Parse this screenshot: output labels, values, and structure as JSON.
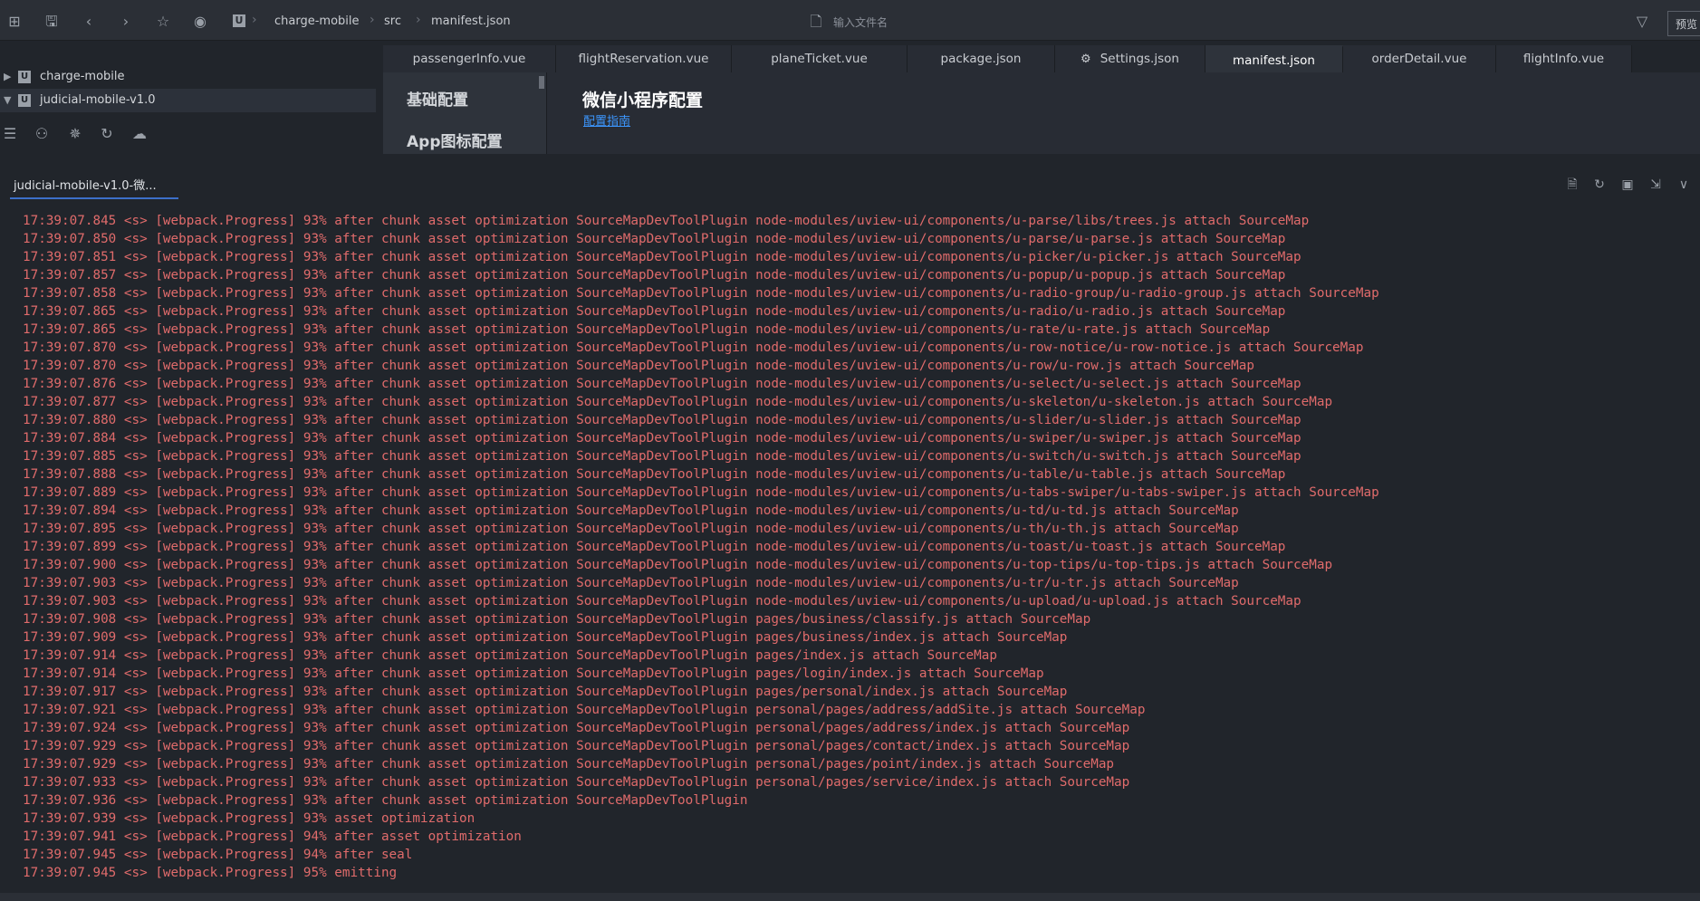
{
  "toolbar": {
    "breadcrumb": [
      "charge-mobile",
      "src",
      "manifest.json"
    ],
    "search_placeholder": "输入文件名",
    "preview_label": "预览"
  },
  "sidebar": {
    "projects": [
      {
        "label": "charge-mobile",
        "expanded": false
      },
      {
        "label": "judicial-mobile-v1.0",
        "expanded": true
      }
    ]
  },
  "tabs": [
    {
      "label": "passengerInfo.vue"
    },
    {
      "label": "flightReservation.vue"
    },
    {
      "label": "planeTicket.vue"
    },
    {
      "label": "package.json"
    },
    {
      "label": "Settings.json"
    },
    {
      "label": "manifest.json",
      "active": true
    },
    {
      "label": "orderDetail.vue"
    },
    {
      "label": "flightInfo.vue"
    }
  ],
  "manifest": {
    "nav_items": [
      "基础配置",
      "App图标配置"
    ],
    "title": "微信小程序配置",
    "guide_link": "配置指南"
  },
  "console": {
    "tab_label": "judicial-mobile-v1.0-微...",
    "lines": [
      "17:39:07.845 <s> [webpack.Progress] 93% after chunk asset optimization SourceMapDevToolPlugin node-modules/uview-ui/components/u-parse/libs/trees.js attach SourceMap",
      "17:39:07.850 <s> [webpack.Progress] 93% after chunk asset optimization SourceMapDevToolPlugin node-modules/uview-ui/components/u-parse/u-parse.js attach SourceMap",
      "17:39:07.851 <s> [webpack.Progress] 93% after chunk asset optimization SourceMapDevToolPlugin node-modules/uview-ui/components/u-picker/u-picker.js attach SourceMap",
      "17:39:07.857 <s> [webpack.Progress] 93% after chunk asset optimization SourceMapDevToolPlugin node-modules/uview-ui/components/u-popup/u-popup.js attach SourceMap",
      "17:39:07.858 <s> [webpack.Progress] 93% after chunk asset optimization SourceMapDevToolPlugin node-modules/uview-ui/components/u-radio-group/u-radio-group.js attach SourceMap",
      "17:39:07.865 <s> [webpack.Progress] 93% after chunk asset optimization SourceMapDevToolPlugin node-modules/uview-ui/components/u-radio/u-radio.js attach SourceMap",
      "17:39:07.865 <s> [webpack.Progress] 93% after chunk asset optimization SourceMapDevToolPlugin node-modules/uview-ui/components/u-rate/u-rate.js attach SourceMap",
      "17:39:07.870 <s> [webpack.Progress] 93% after chunk asset optimization SourceMapDevToolPlugin node-modules/uview-ui/components/u-row-notice/u-row-notice.js attach SourceMap",
      "17:39:07.870 <s> [webpack.Progress] 93% after chunk asset optimization SourceMapDevToolPlugin node-modules/uview-ui/components/u-row/u-row.js attach SourceMap",
      "17:39:07.876 <s> [webpack.Progress] 93% after chunk asset optimization SourceMapDevToolPlugin node-modules/uview-ui/components/u-select/u-select.js attach SourceMap",
      "17:39:07.877 <s> [webpack.Progress] 93% after chunk asset optimization SourceMapDevToolPlugin node-modules/uview-ui/components/u-skeleton/u-skeleton.js attach SourceMap",
      "17:39:07.880 <s> [webpack.Progress] 93% after chunk asset optimization SourceMapDevToolPlugin node-modules/uview-ui/components/u-slider/u-slider.js attach SourceMap",
      "17:39:07.884 <s> [webpack.Progress] 93% after chunk asset optimization SourceMapDevToolPlugin node-modules/uview-ui/components/u-swiper/u-swiper.js attach SourceMap",
      "17:39:07.885 <s> [webpack.Progress] 93% after chunk asset optimization SourceMapDevToolPlugin node-modules/uview-ui/components/u-switch/u-switch.js attach SourceMap",
      "17:39:07.888 <s> [webpack.Progress] 93% after chunk asset optimization SourceMapDevToolPlugin node-modules/uview-ui/components/u-table/u-table.js attach SourceMap",
      "17:39:07.889 <s> [webpack.Progress] 93% after chunk asset optimization SourceMapDevToolPlugin node-modules/uview-ui/components/u-tabs-swiper/u-tabs-swiper.js attach SourceMap",
      "17:39:07.894 <s> [webpack.Progress] 93% after chunk asset optimization SourceMapDevToolPlugin node-modules/uview-ui/components/u-td/u-td.js attach SourceMap",
      "17:39:07.895 <s> [webpack.Progress] 93% after chunk asset optimization SourceMapDevToolPlugin node-modules/uview-ui/components/u-th/u-th.js attach SourceMap",
      "17:39:07.899 <s> [webpack.Progress] 93% after chunk asset optimization SourceMapDevToolPlugin node-modules/uview-ui/components/u-toast/u-toast.js attach SourceMap",
      "17:39:07.900 <s> [webpack.Progress] 93% after chunk asset optimization SourceMapDevToolPlugin node-modules/uview-ui/components/u-top-tips/u-top-tips.js attach SourceMap",
      "17:39:07.903 <s> [webpack.Progress] 93% after chunk asset optimization SourceMapDevToolPlugin node-modules/uview-ui/components/u-tr/u-tr.js attach SourceMap",
      "17:39:07.903 <s> [webpack.Progress] 93% after chunk asset optimization SourceMapDevToolPlugin node-modules/uview-ui/components/u-upload/u-upload.js attach SourceMap",
      "17:39:07.908 <s> [webpack.Progress] 93% after chunk asset optimization SourceMapDevToolPlugin pages/business/classify.js attach SourceMap",
      "17:39:07.909 <s> [webpack.Progress] 93% after chunk asset optimization SourceMapDevToolPlugin pages/business/index.js attach SourceMap",
      "17:39:07.914 <s> [webpack.Progress] 93% after chunk asset optimization SourceMapDevToolPlugin pages/index.js attach SourceMap",
      "17:39:07.914 <s> [webpack.Progress] 93% after chunk asset optimization SourceMapDevToolPlugin pages/login/index.js attach SourceMap",
      "17:39:07.917 <s> [webpack.Progress] 93% after chunk asset optimization SourceMapDevToolPlugin pages/personal/index.js attach SourceMap",
      "17:39:07.921 <s> [webpack.Progress] 93% after chunk asset optimization SourceMapDevToolPlugin personal/pages/address/addSite.js attach SourceMap",
      "17:39:07.924 <s> [webpack.Progress] 93% after chunk asset optimization SourceMapDevToolPlugin personal/pages/address/index.js attach SourceMap",
      "17:39:07.929 <s> [webpack.Progress] 93% after chunk asset optimization SourceMapDevToolPlugin personal/pages/contact/index.js attach SourceMap",
      "17:39:07.929 <s> [webpack.Progress] 93% after chunk asset optimization SourceMapDevToolPlugin personal/pages/point/index.js attach SourceMap",
      "17:39:07.933 <s> [webpack.Progress] 93% after chunk asset optimization SourceMapDevToolPlugin personal/pages/service/index.js attach SourceMap",
      "17:39:07.936 <s> [webpack.Progress] 93% after chunk asset optimization SourceMapDevToolPlugin",
      "17:39:07.939 <s> [webpack.Progress] 93% asset optimization",
      "17:39:07.941 <s> [webpack.Progress] 94% after asset optimization",
      "17:39:07.945 <s> [webpack.Progress] 94% after seal",
      "17:39:07.945 <s> [webpack.Progress] 95% emitting"
    ]
  }
}
